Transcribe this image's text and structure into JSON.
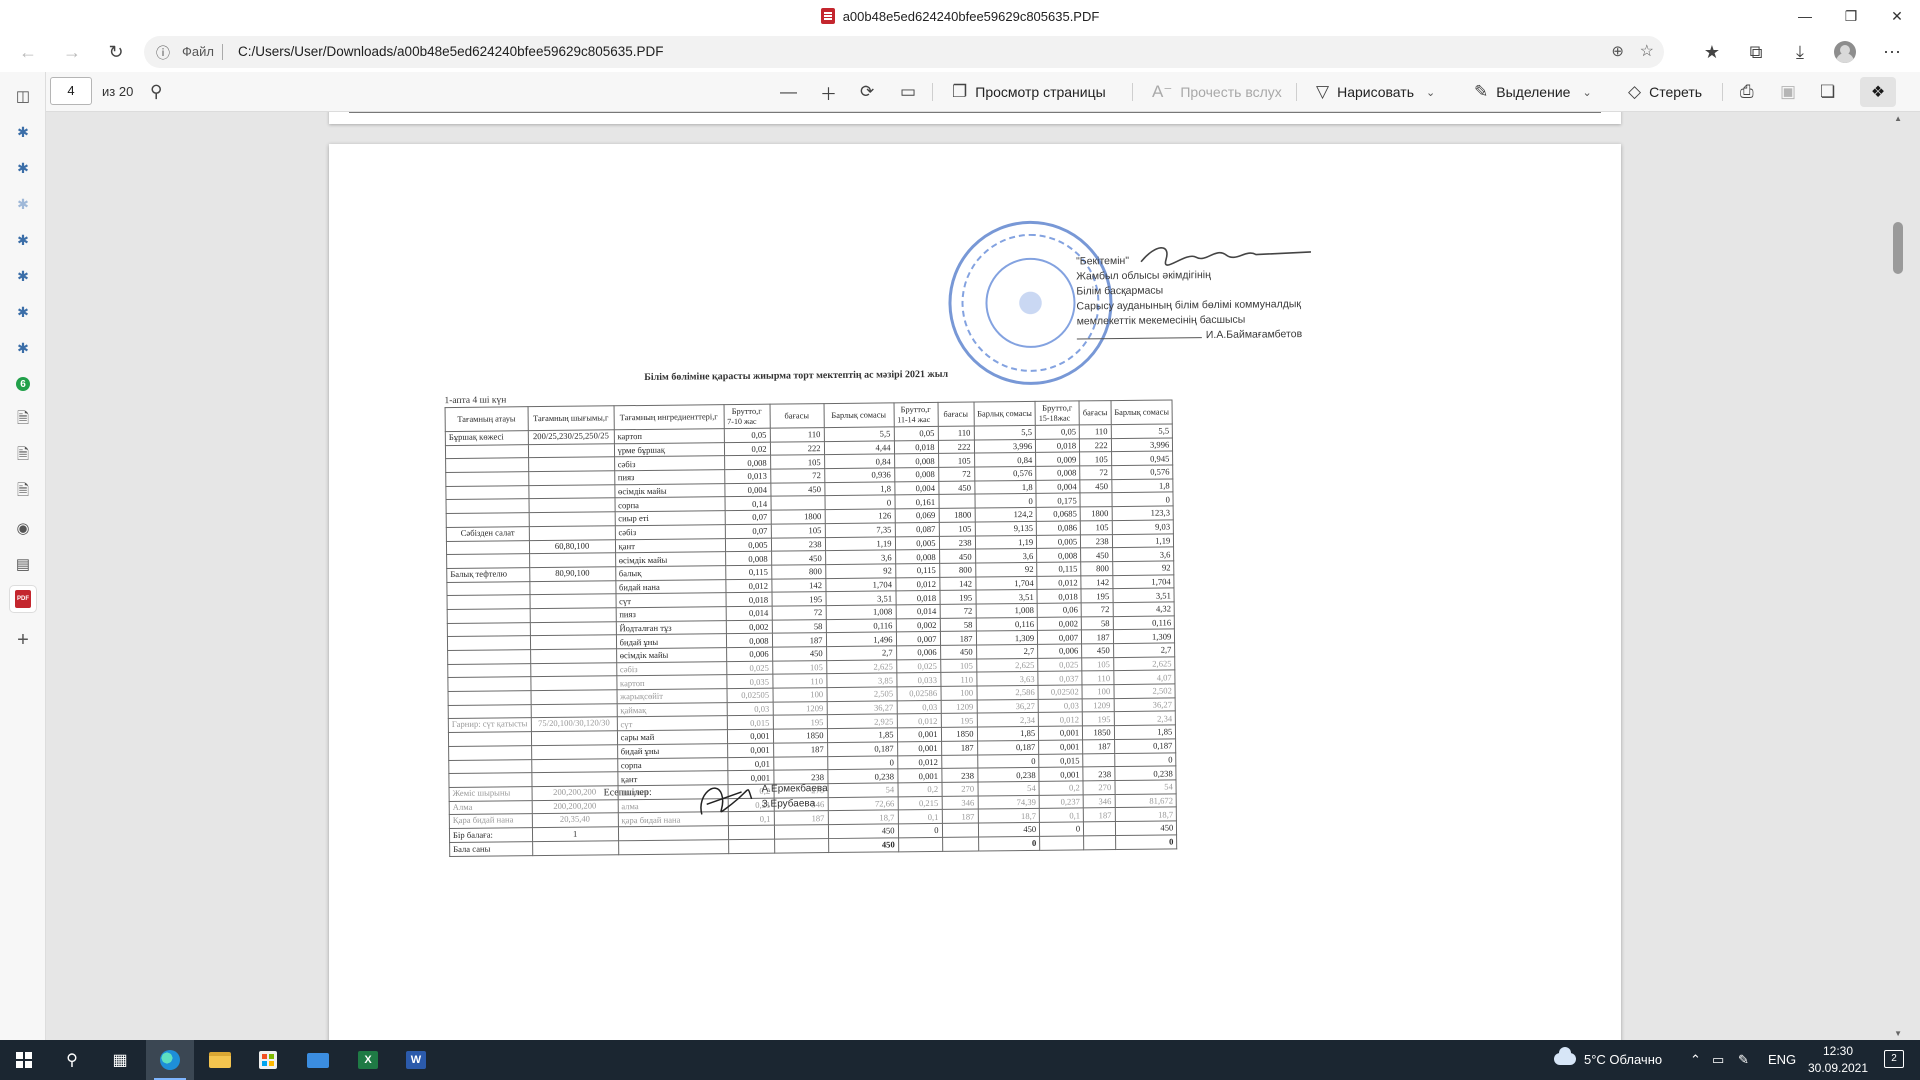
{
  "window": {
    "title": "a00b48e5ed624240bfee59629c805635.PDF"
  },
  "navbar": {
    "file_label": "Файл",
    "url": "C:/Users/User/Downloads/a00b48e5ed624240bfee59629c805635.PDF"
  },
  "pdf_toolbar": {
    "page_number": "4",
    "page_count": "из 20",
    "page_view_label": "Просмотр страницы",
    "read_aloud_label": "Прочесть вслух",
    "draw_label": "Нарисовать",
    "highlight_label": "Выделение",
    "erase_label": "Стереть"
  },
  "document": {
    "approval": {
      "line1": "\"Бекітемін\"",
      "line2": "Жамбыл облысы  әкімдігінің",
      "line3": "Білім басқармасы",
      "line4": "Сарысу ауданының білім бөлімі коммуналдық",
      "line5": "мемлекеттік мекемесінің басшысы",
      "name": "И.А.Баймағамбетов"
    },
    "title": "Білім бөліміне қарасты жиырма торт мектептің ас мәзірі  2021 жыл",
    "week_label": "1-апта 4 ші күн",
    "headers": {
      "dish": "Тағамның атауы",
      "portion": "Тағамның шығымы,г",
      "ingredients": "Тағамның ингредиенттері,г",
      "gross": "Брутто,г",
      "price": "бағасы",
      "total": "Барлық сомасы",
      "age1": "7-10 жас",
      "age2": "11-14 жас",
      "age3": "15-18жас"
    },
    "rows": [
      [
        "Бұршақ көжесі",
        "200/25,230/25,250/25",
        "картоп",
        "0,05",
        "110",
        "5,5",
        "0,05",
        "110",
        "5,5",
        "0,05",
        "110",
        "5,5"
      ],
      [
        "",
        "",
        "үрме бұршақ",
        "0,02",
        "222",
        "4,44",
        "0,018",
        "222",
        "3,996",
        "0,018",
        "222",
        "3,996"
      ],
      [
        "",
        "",
        "сәбіз",
        "0,008",
        "105",
        "0,84",
        "0,008",
        "105",
        "0,84",
        "0,009",
        "105",
        "0,945"
      ],
      [
        "",
        "",
        "пияз",
        "0,013",
        "72",
        "0,936",
        "0,008",
        "72",
        "0,576",
        "0,008",
        "72",
        "0,576"
      ],
      [
        "",
        "",
        "өсімдік майы",
        "0,004",
        "450",
        "1,8",
        "0,004",
        "450",
        "1,8",
        "0,004",
        "450",
        "1,8"
      ],
      [
        "",
        "",
        "сорпа",
        "0,14",
        "",
        "0",
        "0,161",
        "",
        "0",
        "0,175",
        "",
        "0"
      ],
      [
        "",
        "",
        "сиыр еті",
        "0,07",
        "1800",
        "126",
        "0,069",
        "1800",
        "124,2",
        "0,0685",
        "1800",
        "123,3"
      ],
      [
        "Сәбізден салат",
        "",
        "сәбіз",
        "0,07",
        "105",
        "7,35",
        "0,087",
        "105",
        "9,135",
        "0,086",
        "105",
        "9,03"
      ],
      [
        "",
        "60,80,100",
        "қант",
        "0,005",
        "238",
        "1,19",
        "0,005",
        "238",
        "1,19",
        "0,005",
        "238",
        "1,19"
      ],
      [
        "",
        "",
        "өсімдік майы",
        "0,008",
        "450",
        "3,6",
        "0,008",
        "450",
        "3,6",
        "0,008",
        "450",
        "3,6"
      ],
      [
        "Балық тефтелю",
        "80,90,100",
        "балық",
        "0,115",
        "800",
        "92",
        "0,115",
        "800",
        "92",
        "0,115",
        "800",
        "92"
      ],
      [
        "",
        "",
        "бидай нана",
        "0,012",
        "142",
        "1,704",
        "0,012",
        "142",
        "1,704",
        "0,012",
        "142",
        "1,704"
      ],
      [
        "",
        "",
        "сүт",
        "0,018",
        "195",
        "3,51",
        "0,018",
        "195",
        "3,51",
        "0,018",
        "195",
        "3,51"
      ],
      [
        "",
        "",
        "пияз",
        "0,014",
        "72",
        "1,008",
        "0,014",
        "72",
        "1,008",
        "0,06",
        "72",
        "4,32"
      ],
      [
        "",
        "",
        "Йодталған тұз",
        "0,002",
        "58",
        "0,116",
        "0,002",
        "58",
        "0,116",
        "0,002",
        "58",
        "0,116"
      ],
      [
        "",
        "",
        "бидай ұны",
        "0,008",
        "187",
        "1,496",
        "0,007",
        "187",
        "1,309",
        "0,007",
        "187",
        "1,309"
      ],
      [
        "",
        "",
        "өсімдік майы",
        "0,006",
        "450",
        "2,7",
        "0,006",
        "450",
        "2,7",
        "0,006",
        "450",
        "2,7"
      ],
      [
        "",
        "",
        "сәбіз",
        "0,025",
        "105",
        "2,625",
        "0,025",
        "105",
        "2,625",
        "0,025",
        "105",
        "2,625"
      ],
      [
        "",
        "",
        "картоп",
        "0,035",
        "110",
        "3,85",
        "0,033",
        "110",
        "3,63",
        "0,037",
        "110",
        "4,07"
      ],
      [
        "",
        "",
        "жарықсөйіт",
        "0,02505",
        "100",
        "2,505",
        "0,02586",
        "100",
        "2,586",
        "0,02502",
        "100",
        "2,502"
      ],
      [
        "",
        "",
        "қаймақ",
        "0,03",
        "1209",
        "36,27",
        "0,03",
        "1209",
        "36,27",
        "0,03",
        "1209",
        "36,27"
      ],
      [
        "Гарнир: сүт қатысты",
        "75/20,100/30,120/30",
        "сүт",
        "0,015",
        "195",
        "2,925",
        "0,012",
        "195",
        "2,34",
        "0,012",
        "195",
        "2,34"
      ],
      [
        "",
        "",
        "сары май",
        "0,001",
        "1850",
        "1,85",
        "0,001",
        "1850",
        "1,85",
        "0,001",
        "1850",
        "1,85"
      ],
      [
        "",
        "",
        "бидай ұны",
        "0,001",
        "187",
        "0,187",
        "0,001",
        "187",
        "0,187",
        "0,001",
        "187",
        "0,187"
      ],
      [
        "",
        "",
        "сорпа",
        "0,01",
        "",
        "0",
        "0,012",
        "",
        "0",
        "0,015",
        "",
        "0"
      ],
      [
        "",
        "",
        "қант",
        "0,001",
        "238",
        "0,238",
        "0,001",
        "238",
        "0,238",
        "0,001",
        "238",
        "0,238"
      ],
      [
        "Жеміс шырыны",
        "200,200,200",
        "шырын",
        "0,2",
        "270",
        "54",
        "0,2",
        "270",
        "54",
        "0,2",
        "270",
        "54"
      ],
      [
        "Алма",
        "200,200,200",
        "алма",
        "0,21",
        "346",
        "72,66",
        "0,215",
        "346",
        "74,39",
        "0,237",
        "346",
        "81,672"
      ],
      [
        "Қара бидай нана",
        "20,35,40",
        "қара бидай нана",
        "0,1",
        "187",
        "18,7",
        "0,1",
        "187",
        "18,7",
        "0,1",
        "187",
        "18,7"
      ]
    ],
    "totals": {
      "one_child_label": "Бір балаға:",
      "one_child_count": "1",
      "one_child_v1": "450",
      "one_child_v1b": "0",
      "one_child_v2": "450",
      "one_child_v2b": "0",
      "one_child_v3": "450",
      "children_label": "Бала саны",
      "children_v1": "450",
      "children_v2": "0",
      "children_v3": "0"
    },
    "accountants_label": "Есепшілер:",
    "accountant1": "А.Ермекбаева",
    "accountant2": "З.Ерубаева"
  },
  "taskbar": {
    "weather": "5°C  Облачно",
    "lang": "ENG",
    "time": "12:30",
    "date": "30.09.2021",
    "notifications": "2"
  }
}
